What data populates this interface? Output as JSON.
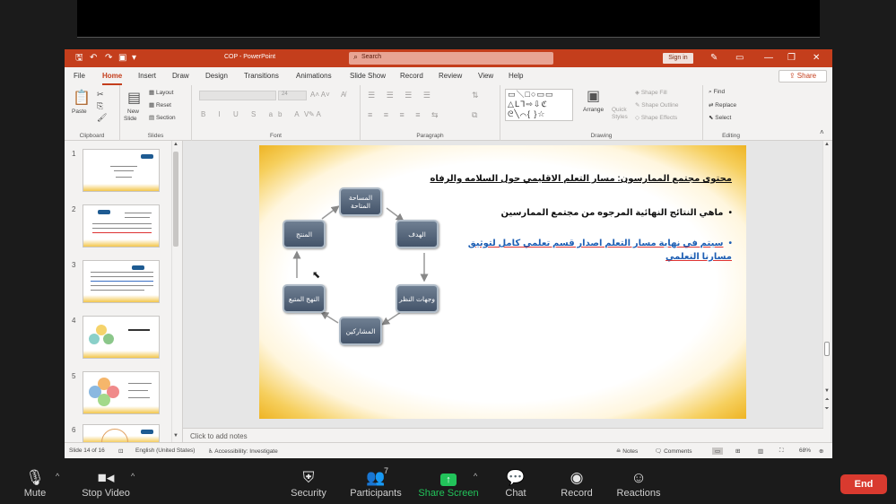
{
  "titlebar": {
    "doc_title": "COP - PowerPoint",
    "search_placeholder": "Search",
    "signin_label": "Sign in"
  },
  "menu": {
    "tabs": [
      "File",
      "Home",
      "Insert",
      "Draw",
      "Design",
      "Transitions",
      "Animations",
      "Slide Show",
      "Record",
      "Review",
      "View",
      "Help"
    ],
    "share_label": "Share"
  },
  "ribbon": {
    "clipboard": {
      "label": "Clipboard",
      "paste": "Paste"
    },
    "slides": {
      "label": "Slides",
      "new_slide_1": "New",
      "new_slide_2": "Slide",
      "layout": "Layout",
      "reset": "Reset",
      "section": "Section"
    },
    "font": {
      "label": "Font",
      "size_value": "24"
    },
    "paragraph": {
      "label": "Paragraph"
    },
    "drawing": {
      "label": "Drawing",
      "arrange": "Arrange",
      "quick_styles_1": "Quick",
      "quick_styles_2": "Styles",
      "shape_fill": "Shape Fill",
      "shape_outline": "Shape Outline",
      "shape_effects": "Shape Effects"
    },
    "editing": {
      "label": "Editing",
      "find": "Find",
      "replace": "Replace",
      "select": "Select"
    }
  },
  "thumbnails": [
    "1",
    "2",
    "3",
    "4",
    "5",
    "6"
  ],
  "slide": {
    "title": "محتوى مجتمع الممارسون: مسار التعلم الاقليمي حول السلامه والرفاه",
    "bullet1": "ماهي النتائج النهائية المرجوه من مجتمع الممارسين",
    "bullet2": "سيتم في نهاية مسار التعلم اصدار قسم تعلمي كامل لتوثيق مسارنا التعلمي",
    "cycle_nodes": {
      "top": "المساحة المتاحة",
      "right_top": "الهدف",
      "right_bottom": "وجهات النظر",
      "bottom": "المشاركين",
      "left_bottom": "النهج المتبع",
      "left_top": "المنتج"
    }
  },
  "notes_placeholder": "Click to add notes",
  "status": {
    "slide_info": "Slide 14 of 16",
    "language": "English (United States)",
    "accessibility": "Accessibility: Investigate",
    "notes": "Notes",
    "comments": "Comments",
    "zoom": "68%"
  },
  "zoom_toolbar": {
    "mute": "Mute",
    "stop_video": "Stop Video",
    "security": "Security",
    "participants": "Participants",
    "participants_count": "7",
    "share_screen": "Share Screen",
    "chat": "Chat",
    "record": "Record",
    "reactions": "Reactions",
    "end": "End"
  },
  "colors": {
    "ppt_accent": "#c43e1c",
    "zoom_green": "#22c35a",
    "end_red": "#d93a2f",
    "cycle_node": "#44546a"
  }
}
